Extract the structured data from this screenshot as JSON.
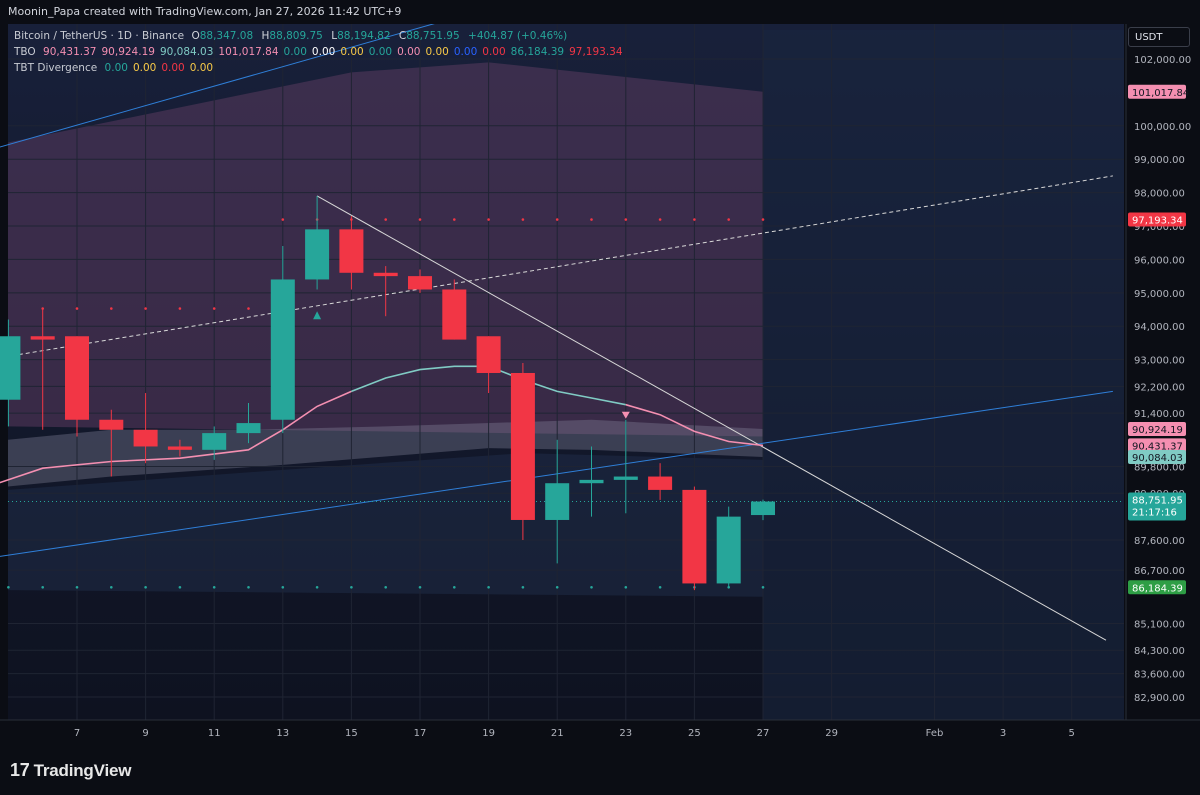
{
  "header": {
    "title": "Moonin_Papa created with TradingView.com, Jan 27, 2026 11:42 UTC+9"
  },
  "legend": {
    "symbol": "Bitcoin / TetherUS · 1D · Binance",
    "ohlc": {
      "o_label": "O",
      "o": "88,347.08",
      "h_label": "H",
      "h": "88,809.75",
      "l_label": "L",
      "l": "88,194.82",
      "c_label": "C",
      "c": "88,751.95",
      "change": "+404.87 (+0.46%)"
    },
    "tbo": {
      "label": "TBO",
      "values": [
        {
          "text": "90,431.37",
          "color": "#f48fb1"
        },
        {
          "text": "90,924.19",
          "color": "#f48fb1"
        },
        {
          "text": "90,084.03",
          "color": "#80cbc4"
        },
        {
          "text": "101,017.84",
          "color": "#f48fb1"
        },
        {
          "text": "0.00",
          "color": "#26a69a"
        },
        {
          "text": "0.00",
          "color": "#ffffff"
        },
        {
          "text": "0.00",
          "color": "#f7c948"
        },
        {
          "text": "0.00",
          "color": "#26a69a"
        },
        {
          "text": "0.00",
          "color": "#f48fb1"
        },
        {
          "text": "0.00",
          "color": "#f7c948"
        },
        {
          "text": "0.00",
          "color": "#2962ff"
        },
        {
          "text": "0.00",
          "color": "#f23645"
        },
        {
          "text": "86,184.39",
          "color": "#26a69a"
        },
        {
          "text": "97,193.34",
          "color": "#f23645"
        }
      ]
    },
    "tbt": {
      "label": "TBT Divergence",
      "values": [
        {
          "text": "0.00",
          "color": "#26a69a"
        },
        {
          "text": "0.00",
          "color": "#f7c948"
        },
        {
          "text": "0.00",
          "color": "#f23645"
        },
        {
          "text": "0.00",
          "color": "#f7c948"
        }
      ]
    }
  },
  "currency_button": "USDT",
  "footer": {
    "logo_mark": "17",
    "logo_text": "TradingView"
  },
  "colors": {
    "up": "#26a69a",
    "down": "#f23645",
    "pink": "#f48fb1",
    "teal_line": "#80cbc4",
    "blue_line": "#2f7fd8",
    "white_line": "#d8d8d8",
    "axis_text": "#b2b5be"
  },
  "chart_data": {
    "type": "candlestick",
    "y_ticks": [
      102000,
      100000,
      99000,
      98000,
      97000,
      96000,
      95000,
      94000,
      93000,
      92200,
      91400,
      89800,
      89000,
      87600,
      86700,
      85100,
      84300,
      83600,
      82900
    ],
    "y_tick_labels": [
      "102,000.00",
      "100,000.00",
      "99,000.00",
      "98,000.00",
      "97,000.00",
      "96,000.00",
      "95,000.00",
      "94,000.00",
      "93,000.00",
      "92,200.00",
      "91,400.00",
      "89,800.00",
      "89,000.00",
      "87,600.00",
      "86,700.00",
      "85,100.00",
      "84,300.00",
      "83,600.00",
      "82,900.00"
    ],
    "x_ticks": [
      {
        "day": 7,
        "label": "7"
      },
      {
        "day": 9,
        "label": "9"
      },
      {
        "day": 11,
        "label": "11"
      },
      {
        "day": 13,
        "label": "13"
      },
      {
        "day": 15,
        "label": "15"
      },
      {
        "day": 17,
        "label": "17"
      },
      {
        "day": 19,
        "label": "19"
      },
      {
        "day": 21,
        "label": "21"
      },
      {
        "day": 23,
        "label": "23"
      },
      {
        "day": 25,
        "label": "25"
      },
      {
        "day": 27,
        "label": "27"
      },
      {
        "day": 29,
        "label": "29"
      },
      {
        "day": 32,
        "label": "Feb"
      },
      {
        "day": 34,
        "label": "3"
      },
      {
        "day": 36,
        "label": "5"
      }
    ],
    "candles": [
      {
        "day": 5,
        "open": 91800,
        "high": 94200,
        "low": 91000,
        "close": 93700
      },
      {
        "day": 6,
        "open": 93700,
        "high": 94500,
        "low": 90900,
        "close": 93600
      },
      {
        "day": 7,
        "open": 93700,
        "high": 93700,
        "low": 90700,
        "close": 91200
      },
      {
        "day": 8,
        "open": 91200,
        "high": 91500,
        "low": 89500,
        "close": 90900
      },
      {
        "day": 9,
        "open": 90900,
        "high": 92000,
        "low": 89900,
        "close": 90400
      },
      {
        "day": 10,
        "open": 90400,
        "high": 90600,
        "low": 90100,
        "close": 90300
      },
      {
        "day": 11,
        "open": 90300,
        "high": 91000,
        "low": 90000,
        "close": 90800
      },
      {
        "day": 12,
        "open": 90800,
        "high": 91700,
        "low": 90500,
        "close": 91100
      },
      {
        "day": 13,
        "open": 91200,
        "high": 96400,
        "low": 90800,
        "close": 95400
      },
      {
        "day": 14,
        "open": 95400,
        "high": 97900,
        "low": 95100,
        "close": 96900
      },
      {
        "day": 15,
        "open": 96900,
        "high": 97300,
        "low": 95100,
        "close": 95600
      },
      {
        "day": 16,
        "open": 95600,
        "high": 95800,
        "low": 94300,
        "close": 95500
      },
      {
        "day": 17,
        "open": 95500,
        "high": 95700,
        "low": 95000,
        "close": 95100
      },
      {
        "day": 18,
        "open": 95100,
        "high": 95400,
        "low": 93600,
        "close": 93600
      },
      {
        "day": 19,
        "open": 93700,
        "high": 93700,
        "low": 92000,
        "close": 92600
      },
      {
        "day": 20,
        "open": 92600,
        "high": 92900,
        "low": 87600,
        "close": 88200
      },
      {
        "day": 21,
        "open": 88200,
        "high": 90600,
        "low": 86900,
        "close": 89300
      },
      {
        "day": 22,
        "open": 89300,
        "high": 90400,
        "low": 88300,
        "close": 89400
      },
      {
        "day": 23,
        "open": 89400,
        "high": 91200,
        "low": 88400,
        "close": 89500
      },
      {
        "day": 24,
        "open": 89500,
        "high": 89900,
        "low": 88800,
        "close": 89100
      },
      {
        "day": 25,
        "open": 89100,
        "high": 89200,
        "low": 86100,
        "close": 86300
      },
      {
        "day": 26,
        "open": 86300,
        "high": 88600,
        "low": 86200,
        "close": 88300
      },
      {
        "day": 27,
        "open": 88347.08,
        "high": 88809.75,
        "low": 88194.82,
        "close": 88751.95
      }
    ],
    "price_labels": [
      {
        "value": 101017.84,
        "text": "101,017.84",
        "color": "#f48fb1",
        "text_color": "#131722"
      },
      {
        "value": 97193.34,
        "text": "97,193.34",
        "color": "#f23645",
        "text_color": "#ffffff"
      },
      {
        "value": 90924.19,
        "text": "90,924.19",
        "color": "#f48fb1",
        "text_color": "#131722"
      },
      {
        "value": 90431.37,
        "text": "90,431.37",
        "color": "#f48fb1",
        "text_color": "#131722"
      },
      {
        "value": 90084.03,
        "text": "90,084.03",
        "color": "#80cbc4",
        "text_color": "#131722"
      },
      {
        "value": 88751.95,
        "text": "88,751.95",
        "sub": "21:17:16",
        "color": "#26a69a",
        "text_color": "#ffffff"
      },
      {
        "value": 86184.39,
        "text": "86,184.39",
        "color": "#2e9e45",
        "text_color": "#ffffff"
      }
    ],
    "tbo_fast_line": [
      {
        "day": 4.7,
        "v": 89300
      },
      {
        "day": 6,
        "v": 89750
      },
      {
        "day": 8,
        "v": 89950
      },
      {
        "day": 10,
        "v": 90050
      },
      {
        "day": 12,
        "v": 90300
      },
      {
        "day": 13,
        "v": 90900
      },
      {
        "day": 14,
        "v": 91600
      },
      {
        "day": 15,
        "v": 92050
      },
      {
        "day": 16,
        "v": 92450
      },
      {
        "day": 17,
        "v": 92700
      },
      {
        "day": 18,
        "v": 92800
      },
      {
        "day": 19,
        "v": 92800
      },
      {
        "day": 20,
        "v": 92400
      },
      {
        "day": 21,
        "v": 92050
      },
      {
        "day": 22,
        "v": 91850
      },
      {
        "day": 23,
        "v": 91650
      },
      {
        "day": 24,
        "v": 91350
      },
      {
        "day": 25,
        "v": 90850
      },
      {
        "day": 26,
        "v": 90550
      },
      {
        "day": 27,
        "v": 90431.37
      }
    ],
    "resistance_dot_level": 97193.34,
    "resistance_dot_days": [
      13,
      14,
      15,
      16,
      17,
      18,
      19,
      20,
      21,
      22,
      23,
      24,
      25,
      26,
      27
    ],
    "resistance_dot_level_left": 94530,
    "resistance_dot_days_left": [
      6,
      7,
      8,
      9,
      10,
      11,
      12
    ],
    "support_dot_level": 86184.39,
    "support_dot_days": [
      5,
      6,
      7,
      8,
      9,
      10,
      11,
      12,
      13,
      14,
      15,
      16,
      17,
      18,
      19,
      20,
      21,
      22,
      23,
      24,
      25,
      26,
      27
    ],
    "signals": [
      {
        "day": 14,
        "v": 94300,
        "type": "up"
      },
      {
        "day": 23,
        "v": 91350,
        "type": "down"
      }
    ],
    "trendlines": [
      {
        "kind": "channel_upper",
        "d1": 4.7,
        "v1": 99350,
        "d2": 27.5,
        "v2": 106000
      },
      {
        "kind": "channel_mid",
        "d1": 4.7,
        "v1": 93050,
        "d2": 37.2,
        "v2": 98500
      },
      {
        "kind": "channel_lower",
        "d1": 4.7,
        "v1": 87100,
        "d2": 37.2,
        "v2": 92050
      },
      {
        "kind": "down_trend",
        "d1": 14,
        "v1": 97900,
        "d2": 37,
        "v2": 84600
      }
    ]
  }
}
